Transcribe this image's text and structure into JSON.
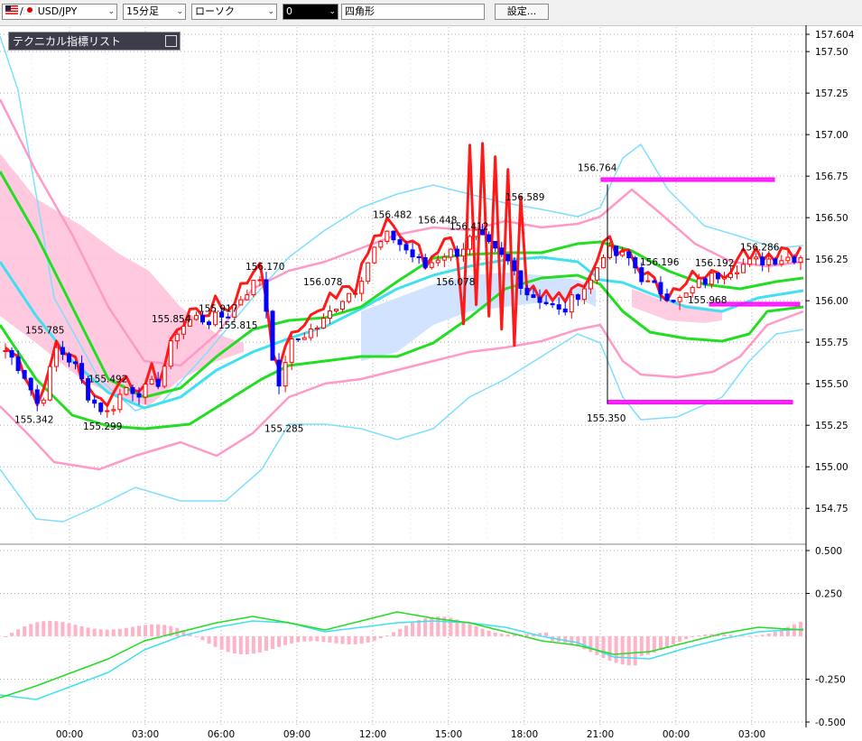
{
  "toolbar": {
    "symbol": "USD/JPY",
    "timeframe": "15分足",
    "chart_style": "ローソク",
    "draw_tool": "0",
    "shape": "四角形",
    "settings_label": "設定..."
  },
  "indicator_panel": {
    "title": "テクニカル指標リスト",
    "button": "□"
  },
  "colors": {
    "up_candle": "#ff0000",
    "down_candle": "#0000ff",
    "ma_red": "#ff1a1a",
    "ma_green": "#22dd22",
    "ma_cyan": "#40e0f0",
    "bollinger_1": "#ff99c8",
    "bollinger_2": "#7fdfff",
    "ichimoku_cloud_1": "#ffc0da",
    "ichimoku_cloud_2": "#cfe2ff",
    "drawn_rects": "#ff00ff",
    "macd_hist": "#ffb3c6"
  },
  "chart_data": [
    {
      "type": "candlestick",
      "x_tick_labels": [
        "00:00",
        "03:00",
        "06:00",
        "09:00",
        "12:00",
        "15:00",
        "18:00",
        "21:00",
        "00:00",
        "03:00"
      ],
      "y_tick_labels": [
        "157.604",
        "157.50",
        "157.25",
        "157.00",
        "156.75",
        "156.50",
        "156.25",
        "156.00",
        "155.75",
        "155.50",
        "155.25",
        "155.00",
        "154.75"
      ],
      "ylim": [
        154.55,
        157.604
      ],
      "last_price": 156.26,
      "price_annotations": [
        {
          "label": "155.785",
          "value": 155.785
        },
        {
          "label": "155.342",
          "value": 155.342
        },
        {
          "label": "155.492",
          "value": 155.492
        },
        {
          "label": "155.299",
          "value": 155.299
        },
        {
          "label": "155.854",
          "value": 155.854
        },
        {
          "label": "155.917",
          "value": 155.917
        },
        {
          "label": "155.815",
          "value": 155.815
        },
        {
          "label": "156.170",
          "value": 156.17
        },
        {
          "label": "155.285",
          "value": 155.285
        },
        {
          "label": "156.078",
          "value": 156.078
        },
        {
          "label": "156.482",
          "value": 156.482
        },
        {
          "label": "156.448",
          "value": 156.448
        },
        {
          "label": "156.412",
          "value": 156.412
        },
        {
          "label": "156.078",
          "value": 156.078
        },
        {
          "label": "156.589",
          "value": 156.589
        },
        {
          "label": "156.764",
          "value": 156.764
        },
        {
          "label": "155.350",
          "value": 155.35
        },
        {
          "label": "156.196",
          "value": 156.196
        },
        {
          "label": "156.192",
          "value": 156.192
        },
        {
          "label": "155.968",
          "value": 155.968
        },
        {
          "label": "156.286",
          "value": 156.286
        }
      ],
      "drawn_rectangles": [
        {
          "top": 156.74,
          "bottom": 156.73
        },
        {
          "top": 155.99,
          "bottom": 155.97
        },
        {
          "top": 155.4,
          "bottom": 155.38
        }
      ]
    },
    {
      "type": "macd",
      "y_tick_labels": [
        "0.500",
        "0.250",
        "-0.250",
        "-0.500"
      ],
      "ylim": [
        -0.5,
        0.5
      ]
    }
  ]
}
